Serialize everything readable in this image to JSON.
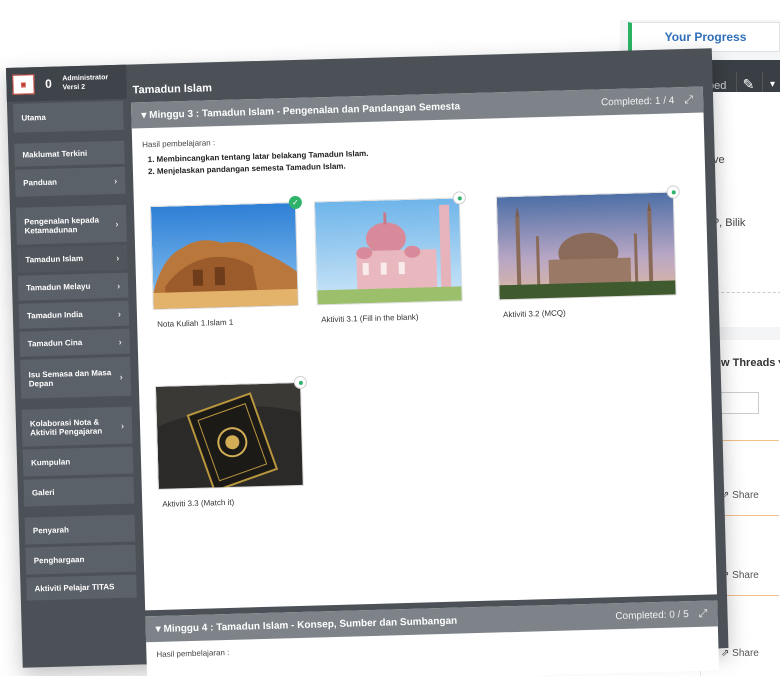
{
  "progress_tab": "Your Progress",
  "bg": {
    "toolbar_text": "oed",
    "text_1": "ve",
    "text_2": "?, Bilik",
    "threads": "w Threads ▾",
    "share": "Share"
  },
  "brand": {
    "badge": "0",
    "user_role": "Administrator",
    "user_version": "Versi 2"
  },
  "sidebar": {
    "items": [
      {
        "label": "Utama",
        "chevron": false
      },
      {
        "label": "Maklumat Terkini",
        "chevron": false
      },
      {
        "label": "Panduan",
        "chevron": true
      },
      {
        "label": "Pengenalan kepada Ketamadunan",
        "chevron": true
      },
      {
        "label": "Tamadun Islam",
        "chevron": true
      },
      {
        "label": "Tamadun Melayu",
        "chevron": true
      },
      {
        "label": "Tamadun India",
        "chevron": true
      },
      {
        "label": "Tamadun Cina",
        "chevron": true
      },
      {
        "label": "Isu Semasa dan Masa Depan",
        "chevron": true
      },
      {
        "label": "Kolaborasi Nota & Aktiviti Pengajaran",
        "chevron": true
      },
      {
        "label": "Kumpulan",
        "chevron": false
      },
      {
        "label": "Galeri",
        "chevron": false
      },
      {
        "label": "Penyarah",
        "chevron": false
      },
      {
        "label": "Penghargaan",
        "chevron": false
      },
      {
        "label": "Aktiviti Pelajar TITAS",
        "chevron": false
      }
    ]
  },
  "main": {
    "course_title": "Tamadun Islam",
    "week3": {
      "title": "Minggu 3 : Tamadun Islam - Pengenalan dan Pandangan Semesta",
      "completed": "Completed: 1 / 4",
      "outcomes_label": "Hasil pembelajaran :",
      "outcomes": [
        "Membincangkan tentang latar belakang Tamadun Islam.",
        "Menjelaskan pandangan semesta Tamadun Islam."
      ],
      "activities": [
        {
          "caption": "Nota Kuliah 1.Islam 1",
          "done": true,
          "image": "desert-rock-tombs"
        },
        {
          "caption": "Aktiviti 3.1 (Fill in the blank)",
          "done": false,
          "image": "pink-mosque"
        },
        {
          "caption": "Aktiviti 3.2 (MCQ)",
          "done": false,
          "image": "blue-mosque"
        },
        {
          "caption": "Aktiviti 3.3 (Match it)",
          "done": false,
          "image": "quran-book"
        }
      ]
    },
    "week4": {
      "title": "Minggu 4 : Tamadun Islam - Konsep, Sumber dan Sumbangan",
      "completed": "Completed: 0 / 5",
      "outcomes_label": "Hasil pembelajaran :"
    }
  },
  "colors": {
    "sidebar_bg": "#5b6168",
    "frame_bg": "#4b5157",
    "panel_header": "#7d8388",
    "accent_green": "#2fb36b",
    "progress_text": "#2f6fb8"
  }
}
